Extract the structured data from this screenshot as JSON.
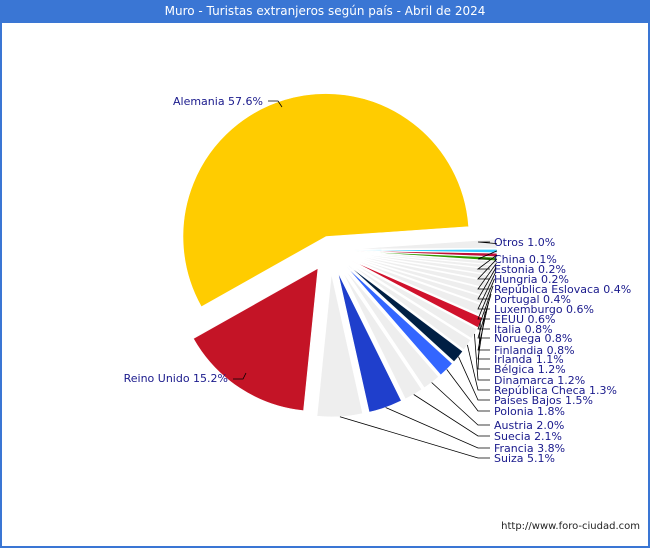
{
  "title": "Muro - Turistas extranjeros según país - Abril de 2024",
  "credit": "http://www.foro-ciudad.com",
  "chart_data": {
    "type": "pie",
    "title": "Muro - Turistas extranjeros según país - Abril de 2024",
    "unit": "%",
    "slices": [
      {
        "name": "Alemania",
        "value": 57.6,
        "color": "#ffcc00",
        "label": "Alemania 57.6%"
      },
      {
        "name": "Reino Unido",
        "value": 15.2,
        "color": "#c41426",
        "label": "Reino Unido 15.2%"
      },
      {
        "name": "Suiza",
        "value": 5.1,
        "color": "#eeeeee",
        "label": "Suiza 5.1%"
      },
      {
        "name": "Francia",
        "value": 3.8,
        "color": "#1f3fcc",
        "label": "Francia 3.8%"
      },
      {
        "name": "Suecia",
        "value": 2.1,
        "color": "#eeeeee",
        "label": "Suecia 2.1%"
      },
      {
        "name": "Austria",
        "value": 2.0,
        "color": "#eeeeee",
        "label": "Austria 2.0%"
      },
      {
        "name": "Polonia",
        "value": 1.8,
        "color": "#3366ff",
        "label": "Polonia 1.8%"
      },
      {
        "name": "Paises Bajos",
        "value": 1.5,
        "color": "#001f44",
        "label": "Paises Bajos 1.5%"
      },
      {
        "name": "República Checa",
        "value": 1.3,
        "color": "#eeeeee",
        "label": "República Checa 1.3%"
      },
      {
        "name": "Dinamarca",
        "value": 1.2,
        "color": "#eeeeee",
        "label": "Dinamarca 1.2%"
      },
      {
        "name": "Bélgica",
        "value": 1.2,
        "color": "#d0122c",
        "label": "Bélgica 1.2%"
      },
      {
        "name": "Irlanda",
        "value": 1.1,
        "color": "#eeeeee",
        "label": "Irlanda 1.1%"
      },
      {
        "name": "Finlandia",
        "value": 0.8,
        "color": "#eeeeee",
        "label": "Finlandia 0.8%"
      },
      {
        "name": "Noruega",
        "value": 0.8,
        "color": "#eeeeee",
        "label": "Noruega 0.8%"
      },
      {
        "name": "Italia",
        "value": 0.8,
        "color": "#eeeeee",
        "label": "Italia 0.8%"
      },
      {
        "name": "EEUU",
        "value": 0.6,
        "color": "#eeeeee",
        "label": "EEUU 0.6%"
      },
      {
        "name": "Luxemburgo",
        "value": 0.6,
        "color": "#eeeeee",
        "label": "Luxemburgo 0.6%"
      },
      {
        "name": "Portugal",
        "value": 0.4,
        "color": "#eeeeee",
        "label": "Portugal 0.4%"
      },
      {
        "name": "República Eslovaca",
        "value": 0.4,
        "color": "#eeeeee",
        "label": "República Eslovaca 0.4%"
      },
      {
        "name": "Hungría",
        "value": 0.2,
        "color": "#339900",
        "label": "Hungria 0.2%"
      },
      {
        "name": "Estonia",
        "value": 0.2,
        "color": "#c0103a",
        "label": "Estonia 0.2%"
      },
      {
        "name": "China",
        "value": 0.1,
        "color": "#33ccff",
        "label": "China 0.1%"
      },
      {
        "name": "Otros",
        "value": 1.0,
        "color": "#eeeeee",
        "label": "Otros 1.0%"
      }
    ]
  }
}
